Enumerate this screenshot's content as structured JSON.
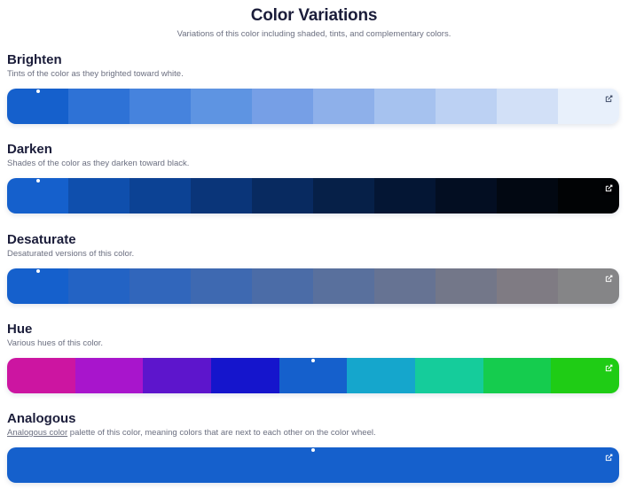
{
  "header": {
    "title": "Color Variations",
    "subtitle": "Variations of this color including shaded, tints, and complementary colors."
  },
  "sections": {
    "brighten": {
      "title": "Brighten",
      "description": "Tints of the color as they brighted toward white.",
      "colors": [
        "#1560cc",
        "#2e72d6",
        "#4683dd",
        "#5e94e2",
        "#769fe6",
        "#8eb0ea",
        "#a6c2ef",
        "#bcd1f3",
        "#d2e0f7",
        "#e8f0fb"
      ]
    },
    "darken": {
      "title": "Darken",
      "description": "Shades of the color as they darken toward black.",
      "colors": [
        "#1560cc",
        "#0f4fad",
        "#0c4294",
        "#0a3579",
        "#082a60",
        "#062048",
        "#041634",
        "#030e22",
        "#020812",
        "#010305"
      ]
    },
    "desaturate": {
      "title": "Desaturate",
      "description": "Desaturated versions of this color.",
      "colors": [
        "#1560cc",
        "#2363c4",
        "#3166bb",
        "#3e69b1",
        "#4b6ca7",
        "#59709d",
        "#667393",
        "#737789",
        "#7f7b83",
        "#858587"
      ]
    },
    "hue": {
      "title": "Hue",
      "description": "Various hues of this color.",
      "colors": [
        "#cc15a1",
        "#a815cc",
        "#5d15cc",
        "#1515cc",
        "#1560cc",
        "#15a6cc",
        "#15cc9b",
        "#15cc4e",
        "#1fcc15"
      ]
    },
    "analogous": {
      "link_text": "Analogous color",
      "title": "Analogous",
      "description_rest": " palette of this color, meaning colors that are next to each other on the color wheel.",
      "colors": [
        "#1560cc"
      ]
    }
  },
  "icons": {
    "edit": "edit-external-icon"
  }
}
